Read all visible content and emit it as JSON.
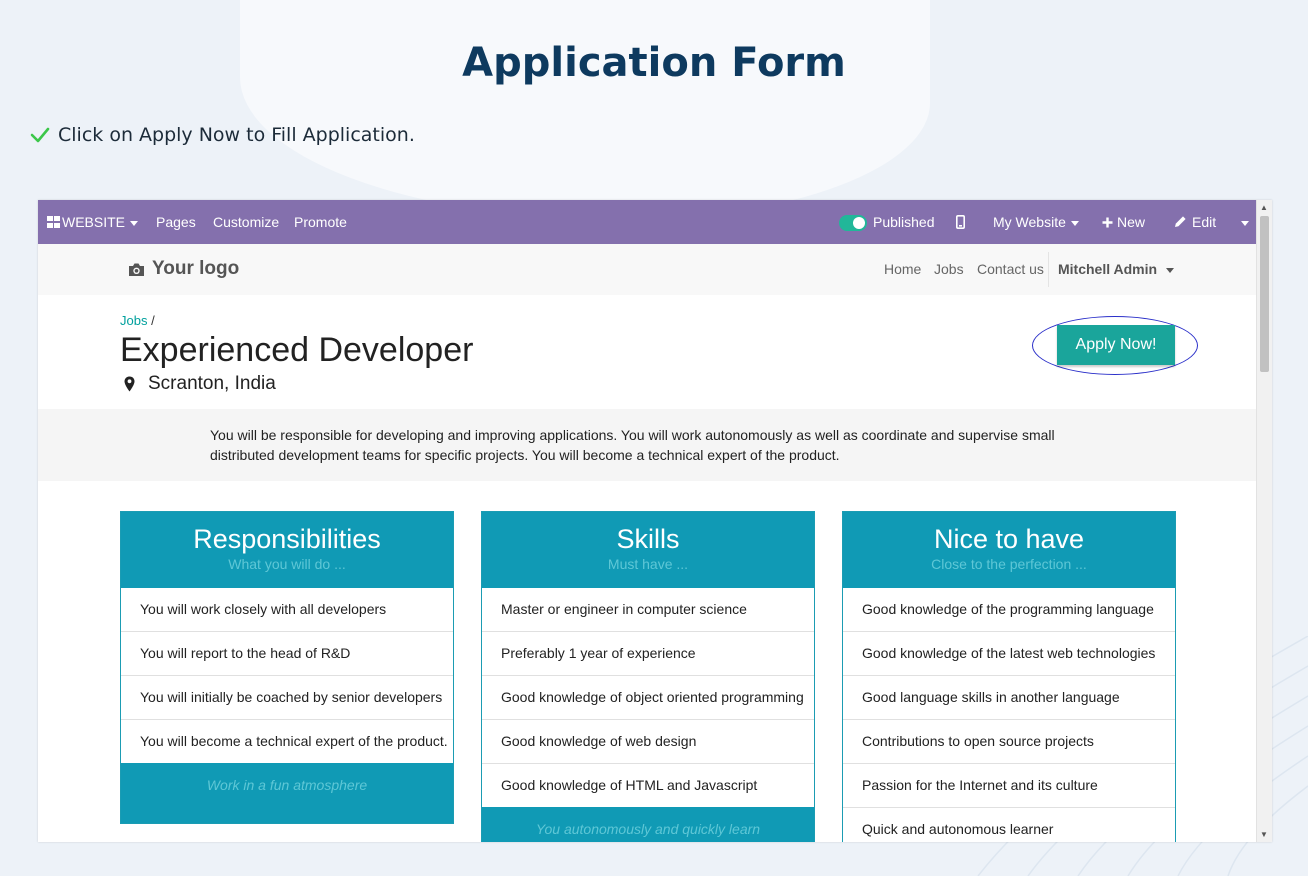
{
  "page": {
    "title": "Application Form",
    "instruction": "Click on Apply Now to Fill Application."
  },
  "editbar": {
    "website_label": "WEBSITE",
    "menu": [
      "Pages",
      "Customize",
      "Promote"
    ],
    "published_label": "Published",
    "my_website_label": "My Website",
    "new_label": "New",
    "edit_label": "Edit"
  },
  "site_header": {
    "logo_text": "Your logo",
    "nav": [
      "Home",
      "Jobs",
      "Contact us"
    ],
    "user": "Mitchell Admin"
  },
  "job": {
    "breadcrumb_link": "Jobs",
    "breadcrumb_sep": " /",
    "title": "Experienced Developer",
    "location": "Scranton, India",
    "apply_label": "Apply Now!",
    "description": "You will be responsible for developing and improving applications. You will work autonomously as well as coordinate and supervise small distributed development teams for specific projects. You will become a technical expert of the product."
  },
  "cards": [
    {
      "title": "Responsibilities",
      "subtitle": "What you will do ...",
      "items": [
        "You will work closely with all developers",
        "You will report to the head of R&D",
        "You will initially be coached by senior developers",
        "You will become a technical expert of the product."
      ],
      "footer": "Work in a fun atmosphere"
    },
    {
      "title": "Skills",
      "subtitle": "Must have ...",
      "items": [
        "Master or engineer in computer science",
        "Preferably 1 year of experience",
        "Good knowledge of object oriented programming",
        "Good knowledge of web design",
        "Good knowledge of HTML and Javascript"
      ],
      "footer": "You autonomously and quickly learn"
    },
    {
      "title": "Nice to have",
      "subtitle": "Close to the perfection ...",
      "items": [
        "Good knowledge of the programming language",
        "Good knowledge of the latest web technologies",
        "Good language skills in another language",
        "Contributions to open source projects",
        "Passion for the Internet and its culture",
        "Quick and autonomous learner"
      ],
      "footer": ""
    }
  ],
  "colors": {
    "editbar": "#8470ad",
    "accent": "#109ab5",
    "apply_button": "#1aa59b",
    "highlight_ring": "#2a2fc9",
    "title": "#0e3a5f"
  }
}
